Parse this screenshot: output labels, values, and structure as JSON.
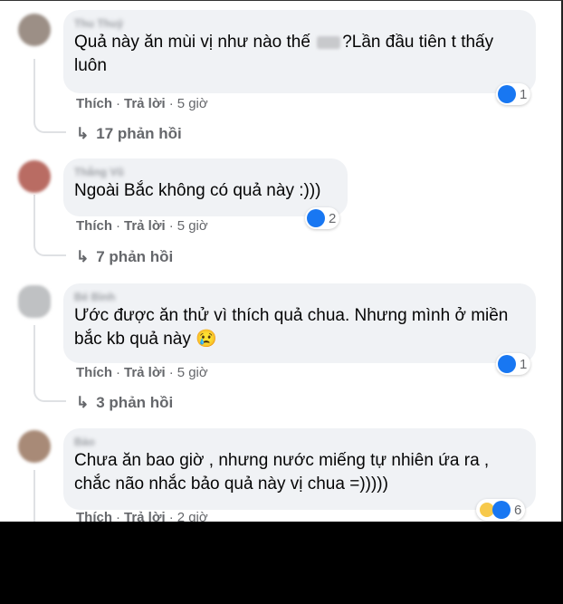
{
  "comments": [
    {
      "author": "Thu Thuỷ",
      "text_before": "Quả này ăn mùi vị như nào thế ",
      "text_after": "?Lần đầu tiên t thấy luôn",
      "like_label": "Thích",
      "reply_label": "Trả lời",
      "time": "5 giờ",
      "reactions": {
        "icons": [
          "like-icon"
        ],
        "count": "1"
      },
      "replies": "17 phản hồi"
    },
    {
      "author": "Thắng Vũ",
      "text": "Ngoài Bắc không có quả này :)))",
      "like_label": "Thích",
      "reply_label": "Trả lời",
      "time": "5 giờ",
      "reactions": {
        "icons": [
          "like-icon"
        ],
        "count": "2"
      },
      "replies": "7 phản hồi"
    },
    {
      "author": "Bé Bình",
      "text": "Ước được ăn thử vì thích quả chua. Nhưng mình ở miền bắc kb quả này 😢",
      "like_label": "Thích",
      "reply_label": "Trả lời",
      "time": "5 giờ",
      "reactions": {
        "icons": [
          "like-icon"
        ],
        "count": "1"
      },
      "replies": "3 phản hồi"
    },
    {
      "author": "Bảo",
      "text": "Chưa ăn bao giờ , nhưng nước miếng tự nhiên ứa ra , chắc não nhắc bảo quả này vị chua =)))))",
      "like_label": "Thích",
      "reply_label": "Trả lời",
      "time": "2 giờ",
      "reactions": {
        "icons": [
          "haha-icon",
          "like-icon"
        ],
        "count": "6"
      }
    }
  ],
  "colors": {
    "bubble": "#f0f2f5",
    "meta_text": "#65676b",
    "like_blue": "#1877f2",
    "haha_yellow": "#f7c94b"
  }
}
